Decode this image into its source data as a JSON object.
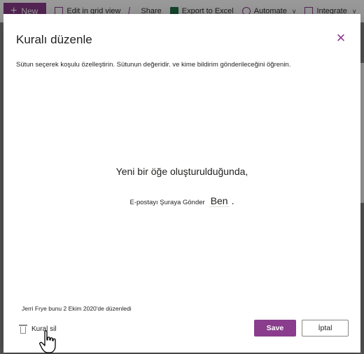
{
  "toolbar": {
    "new_label": "New",
    "grid_label": "Edit in grid view",
    "share_label": "Share",
    "excel_label": "Export to Excel",
    "automate_label": "Automate",
    "integrate_label": "Integrate"
  },
  "dialog": {
    "title": "Kuralı düzenle",
    "subtitle": "Sütun seçerek koşulu özelleştirin. Sütunun değeridir. ve kime bildirim gönderileceğini öğrenin.",
    "rule_heading": "Yeni bir öğe oluşturulduğunda,",
    "rule_action": "E-postayı Şuraya Gönder",
    "rule_recipient": "Ben",
    "rule_end": ".",
    "modified_text": "Jerri Frye bunu 2 Ekim 2020'de düzenledi",
    "delete_label": "Kural sil",
    "save_label": "Save",
    "cancel_label": "İptal"
  },
  "colors": {
    "accent": "#8a3d8c",
    "excel": "#217346"
  }
}
